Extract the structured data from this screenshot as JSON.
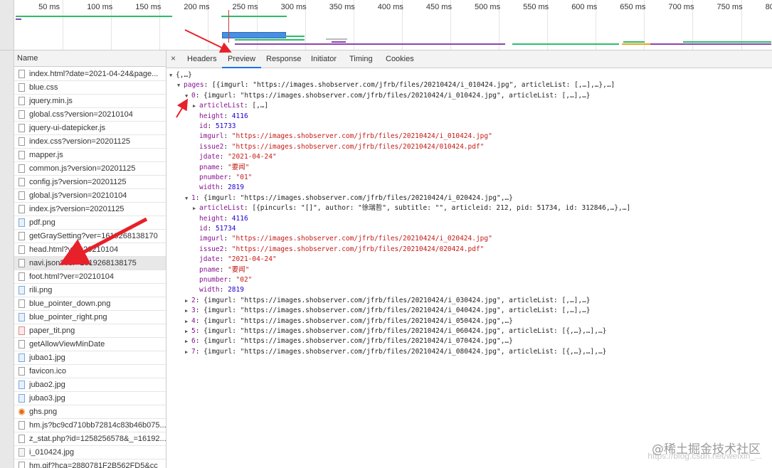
{
  "timeline": {
    "ticks": [
      "50 ms",
      "100 ms",
      "150 ms",
      "200 ms",
      "250 ms",
      "300 ms",
      "350 ms",
      "400 ms",
      "450 ms",
      "500 ms",
      "550 ms",
      "600 ms",
      "650 ms",
      "700 ms",
      "750 ms",
      "80"
    ]
  },
  "name_column": {
    "header": "Name",
    "files": [
      {
        "label": "index.html?date=2021-04-24&page...",
        "icon": "document-icon"
      },
      {
        "label": "blue.css",
        "icon": "document-icon"
      },
      {
        "label": "jquery.min.js",
        "icon": "document-icon"
      },
      {
        "label": "global.css?version=20210104",
        "icon": "document-icon"
      },
      {
        "label": "jquery-ui-datepicker.js",
        "icon": "document-icon"
      },
      {
        "label": "index.css?version=20201125",
        "icon": "document-icon"
      },
      {
        "label": "mapper.js",
        "icon": "document-icon"
      },
      {
        "label": "common.js?version=20201125",
        "icon": "document-icon"
      },
      {
        "label": "config.js?version=20201125",
        "icon": "document-icon"
      },
      {
        "label": "global.js?version=20210104",
        "icon": "document-icon"
      },
      {
        "label": "index.js?version=20201125",
        "icon": "document-icon"
      },
      {
        "label": "pdf.png",
        "icon": "image-icon"
      },
      {
        "label": "getGraySetting?ver=1619268138170",
        "icon": "document-icon"
      },
      {
        "label": "head.html?ver=20210104",
        "icon": "document-icon"
      },
      {
        "label": "navi.json?ver=1619268138175",
        "icon": "document-icon",
        "selected": true
      },
      {
        "label": "foot.html?ver=20210104",
        "icon": "document-icon"
      },
      {
        "label": "rili.png",
        "icon": "image-icon"
      },
      {
        "label": "blue_pointer_down.png",
        "icon": "document-icon"
      },
      {
        "label": "blue_pointer_right.png",
        "icon": "image-icon"
      },
      {
        "label": "paper_tit.png",
        "icon": "red-image-icon"
      },
      {
        "label": "getAllowViewMinDate",
        "icon": "document-icon"
      },
      {
        "label": "jubao1.jpg",
        "icon": "image-icon"
      },
      {
        "label": "favicon.ico",
        "icon": "document-icon"
      },
      {
        "label": "jubao2.jpg",
        "icon": "image-icon"
      },
      {
        "label": "jubao3.jpg",
        "icon": "image-icon"
      },
      {
        "label": "ghs.png",
        "icon": "badge-icon"
      },
      {
        "label": "hm.js?bc9cd710bb72814c83b46b075...",
        "icon": "document-icon"
      },
      {
        "label": "z_stat.php?id=1258256578&_=16192...",
        "icon": "document-icon"
      },
      {
        "label": "i_010424.jpg",
        "icon": "pdf-image-icon"
      },
      {
        "label": "hm.gif?hca=2880781F2B562FD5&cc",
        "icon": "document-icon"
      }
    ]
  },
  "detail": {
    "close_label": "×",
    "tabs": [
      {
        "label": "Headers",
        "active": false
      },
      {
        "label": "Preview",
        "active": true
      },
      {
        "label": "Response",
        "active": false
      },
      {
        "label": "Initiator",
        "active": false
      },
      {
        "label": "Timing",
        "active": false
      },
      {
        "label": "Cookies",
        "active": false
      }
    ]
  },
  "preview": {
    "lines": [
      {
        "indent": 0,
        "tri": "open",
        "parts": [
          [
            "plain",
            "{,…}"
          ]
        ]
      },
      {
        "indent": 1,
        "tri": "open",
        "parts": [
          [
            "key",
            "pages"
          ],
          [
            "plain",
            ": [{imgurl: \"https://images.shobserver.com/jfrb/files/20210424/i_010424.jpg\", articleList: [,…],…},…]"
          ]
        ]
      },
      {
        "indent": 2,
        "tri": "open",
        "parts": [
          [
            "key",
            "0"
          ],
          [
            "plain",
            ": {imgurl: \"https://images.shobserver.com/jfrb/files/20210424/i_010424.jpg\", articleList: [,…],…}"
          ]
        ]
      },
      {
        "indent": 3,
        "tri": "closed",
        "parts": [
          [
            "key",
            "articleList"
          ],
          [
            "plain",
            ": [,…]"
          ]
        ]
      },
      {
        "indent": 3,
        "tri": "none",
        "parts": [
          [
            "key",
            "height"
          ],
          [
            "plain",
            ": "
          ],
          [
            "num",
            "4116"
          ]
        ]
      },
      {
        "indent": 3,
        "tri": "none",
        "parts": [
          [
            "key",
            "id"
          ],
          [
            "plain",
            ": "
          ],
          [
            "num",
            "51733"
          ]
        ]
      },
      {
        "indent": 3,
        "tri": "none",
        "parts": [
          [
            "key",
            "imgurl"
          ],
          [
            "plain",
            ": "
          ],
          [
            "str",
            "\"https://images.shobserver.com/jfrb/files/20210424/i_010424.jpg\""
          ]
        ]
      },
      {
        "indent": 3,
        "tri": "none",
        "parts": [
          [
            "key",
            "issue2"
          ],
          [
            "plain",
            ": "
          ],
          [
            "str",
            "\"https://images.shobserver.com/jfrb/files/20210424/010424.pdf\""
          ]
        ]
      },
      {
        "indent": 3,
        "tri": "none",
        "parts": [
          [
            "key",
            "jdate"
          ],
          [
            "plain",
            ": "
          ],
          [
            "str",
            "\"2021-04-24\""
          ]
        ]
      },
      {
        "indent": 3,
        "tri": "none",
        "parts": [
          [
            "key",
            "pname"
          ],
          [
            "plain",
            ": "
          ],
          [
            "str",
            "\"要闻\""
          ]
        ]
      },
      {
        "indent": 3,
        "tri": "none",
        "parts": [
          [
            "key",
            "pnumber"
          ],
          [
            "plain",
            ": "
          ],
          [
            "str",
            "\"01\""
          ]
        ]
      },
      {
        "indent": 3,
        "tri": "none",
        "parts": [
          [
            "key",
            "width"
          ],
          [
            "plain",
            ": "
          ],
          [
            "num",
            "2819"
          ]
        ]
      },
      {
        "indent": 2,
        "tri": "open",
        "parts": [
          [
            "key",
            "1"
          ],
          [
            "plain",
            ": {imgurl: \"https://images.shobserver.com/jfrb/files/20210424/i_020424.jpg\",…}"
          ]
        ]
      },
      {
        "indent": 3,
        "tri": "closed",
        "parts": [
          [
            "key",
            "articleList"
          ],
          [
            "plain",
            ": [{pincurls: \"[]\", author: \"徐瑞哲\", subtitle: \"\", articleid: 212, pid: 51734, id: 312846,…},…]"
          ]
        ]
      },
      {
        "indent": 3,
        "tri": "none",
        "parts": [
          [
            "key",
            "height"
          ],
          [
            "plain",
            ": "
          ],
          [
            "num",
            "4116"
          ]
        ]
      },
      {
        "indent": 3,
        "tri": "none",
        "parts": [
          [
            "key",
            "id"
          ],
          [
            "plain",
            ": "
          ],
          [
            "num",
            "51734"
          ]
        ]
      },
      {
        "indent": 3,
        "tri": "none",
        "parts": [
          [
            "key",
            "imgurl"
          ],
          [
            "plain",
            ": "
          ],
          [
            "str",
            "\"https://images.shobserver.com/jfrb/files/20210424/i_020424.jpg\""
          ]
        ]
      },
      {
        "indent": 3,
        "tri": "none",
        "parts": [
          [
            "key",
            "issue2"
          ],
          [
            "plain",
            ": "
          ],
          [
            "str",
            "\"https://images.shobserver.com/jfrb/files/20210424/020424.pdf\""
          ]
        ]
      },
      {
        "indent": 3,
        "tri": "none",
        "parts": [
          [
            "key",
            "jdate"
          ],
          [
            "plain",
            ": "
          ],
          [
            "str",
            "\"2021-04-24\""
          ]
        ]
      },
      {
        "indent": 3,
        "tri": "none",
        "parts": [
          [
            "key",
            "pname"
          ],
          [
            "plain",
            ": "
          ],
          [
            "str",
            "\"要闻\""
          ]
        ]
      },
      {
        "indent": 3,
        "tri": "none",
        "parts": [
          [
            "key",
            "pnumber"
          ],
          [
            "plain",
            ": "
          ],
          [
            "str",
            "\"02\""
          ]
        ]
      },
      {
        "indent": 3,
        "tri": "none",
        "parts": [
          [
            "key",
            "width"
          ],
          [
            "plain",
            ": "
          ],
          [
            "num",
            "2819"
          ]
        ]
      },
      {
        "indent": 2,
        "tri": "closed",
        "parts": [
          [
            "key",
            "2"
          ],
          [
            "plain",
            ": {imgurl: \"https://images.shobserver.com/jfrb/files/20210424/i_030424.jpg\", articleList: [,…],…}"
          ]
        ]
      },
      {
        "indent": 2,
        "tri": "closed",
        "parts": [
          [
            "key",
            "3"
          ],
          [
            "plain",
            ": {imgurl: \"https://images.shobserver.com/jfrb/files/20210424/i_040424.jpg\", articleList: [,…],…}"
          ]
        ]
      },
      {
        "indent": 2,
        "tri": "closed",
        "parts": [
          [
            "key",
            "4"
          ],
          [
            "plain",
            ": {imgurl: \"https://images.shobserver.com/jfrb/files/20210424/i_050424.jpg\",…}"
          ]
        ]
      },
      {
        "indent": 2,
        "tri": "closed",
        "parts": [
          [
            "key",
            "5"
          ],
          [
            "plain",
            ": {imgurl: \"https://images.shobserver.com/jfrb/files/20210424/i_060424.jpg\", articleList: [{,…},…],…}"
          ]
        ]
      },
      {
        "indent": 2,
        "tri": "closed",
        "parts": [
          [
            "key",
            "6"
          ],
          [
            "plain",
            ": {imgurl: \"https://images.shobserver.com/jfrb/files/20210424/i_070424.jpg\",…}"
          ]
        ]
      },
      {
        "indent": 2,
        "tri": "closed",
        "parts": [
          [
            "key",
            "7"
          ],
          [
            "plain",
            ": {imgurl: \"https://images.shobserver.com/jfrb/files/20210424/i_080424.jpg\", articleList: [{,…},…],…}"
          ]
        ]
      }
    ]
  },
  "watermark": {
    "text": "@稀土掘金技术社区",
    "url": "https://blog.csdn.net/weixin_..."
  },
  "colors": {
    "accent": "#1a73e8",
    "arrow": "#e8202a",
    "key": "#881391",
    "string": "#c41a16",
    "number": "#1c00cf"
  }
}
